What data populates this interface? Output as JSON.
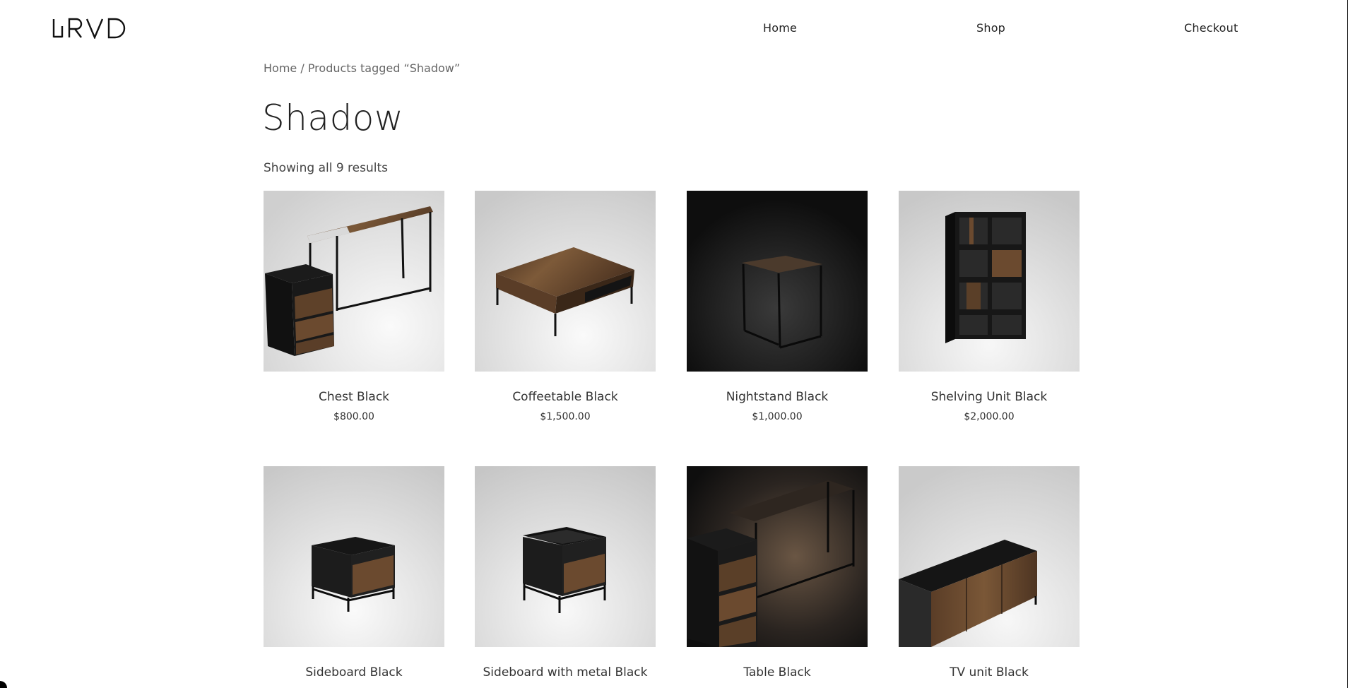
{
  "header": {
    "logo_text": "HRVD",
    "nav": [
      {
        "label": "Home"
      },
      {
        "label": "Shop"
      },
      {
        "label": "Checkout"
      }
    ]
  },
  "breadcrumb": {
    "home": "Home",
    "separator": " / ",
    "current": "Products tagged “Shadow”"
  },
  "page": {
    "title": "Shadow",
    "result_count": "Showing all 9 results"
  },
  "products": [
    {
      "name": "Chest Black",
      "price": "$800.00",
      "image": "desk-with-drawers"
    },
    {
      "name": "Coffeetable Black",
      "price": "$1,500.00",
      "image": "coffee-table"
    },
    {
      "name": "Nightstand Black",
      "price": "$1,000.00",
      "image": "nightstand-dark"
    },
    {
      "name": "Shelving Unit Black",
      "price": "$2,000.00",
      "image": "shelving-unit"
    },
    {
      "name": "Sideboard Black",
      "price": "",
      "image": "sideboard"
    },
    {
      "name": "Sideboard with metal Black",
      "price": "",
      "image": "sideboard-metal"
    },
    {
      "name": "Table Black",
      "price": "",
      "image": "table-dark"
    },
    {
      "name": "TV unit Black",
      "price": "",
      "image": "tv-unit"
    }
  ],
  "colors": {
    "wood": "#6b4a2f",
    "black": "#1a1a1a",
    "light_bg": "#e6e6e6",
    "dark_bg": "#111111"
  }
}
